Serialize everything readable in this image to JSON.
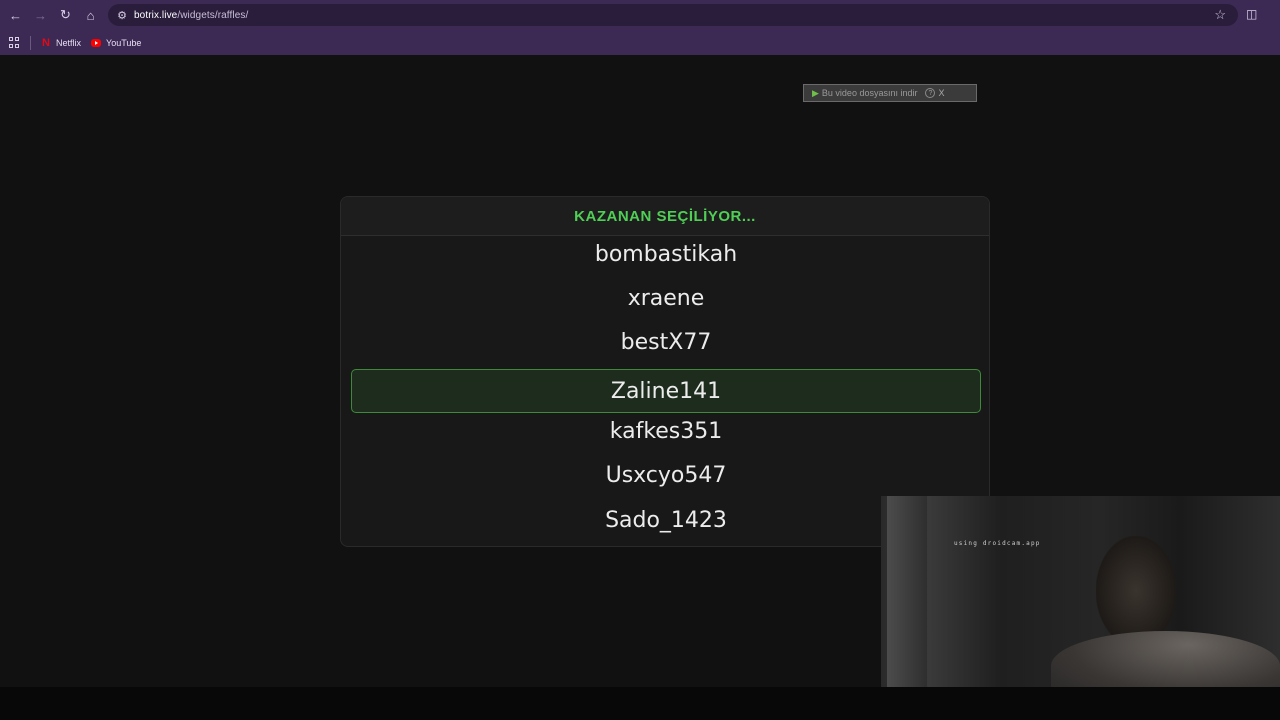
{
  "browser": {
    "url_host": "botrix.live",
    "url_path": "/widgets/raffles/",
    "bookmarks": [
      {
        "label": "Netflix",
        "icon": "netflix-icon"
      },
      {
        "label": "YouTube",
        "icon": "youtube-icon"
      }
    ]
  },
  "download_bar": {
    "label": "Bu video dosyasını indir",
    "help": "?",
    "close": "X"
  },
  "raffle": {
    "title": "KAZANAN SEÇİLİYOR...",
    "names": [
      "bombastikah",
      "xraene",
      "bestX77",
      "Zaline141",
      "kafkes351",
      "Usxcyo547",
      "Sado_1423"
    ],
    "highlight_color": "#3f8a3a",
    "title_color": "#4fcf55"
  },
  "webcam": {
    "watermark": "using droidcam.app"
  }
}
